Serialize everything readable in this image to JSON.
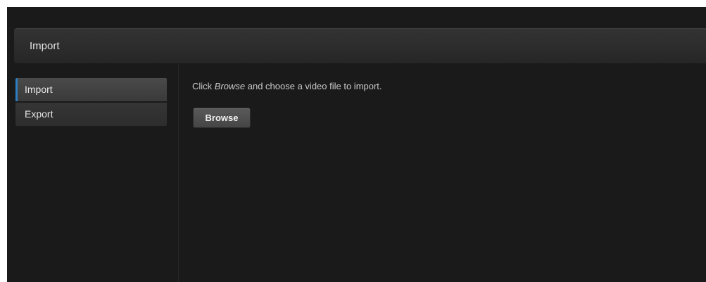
{
  "header": {
    "title": "Import"
  },
  "sidebar": {
    "items": [
      {
        "label": "Import",
        "active": true
      },
      {
        "label": "Export",
        "active": false
      }
    ]
  },
  "main": {
    "instruction_prefix": "Click ",
    "instruction_emphasis": "Browse",
    "instruction_suffix": " and choose a video file to import.",
    "browse_label": "Browse"
  },
  "colors": {
    "background": "#1a1a1a",
    "accent": "#2e7dc0",
    "text": "#d8d8d8"
  }
}
